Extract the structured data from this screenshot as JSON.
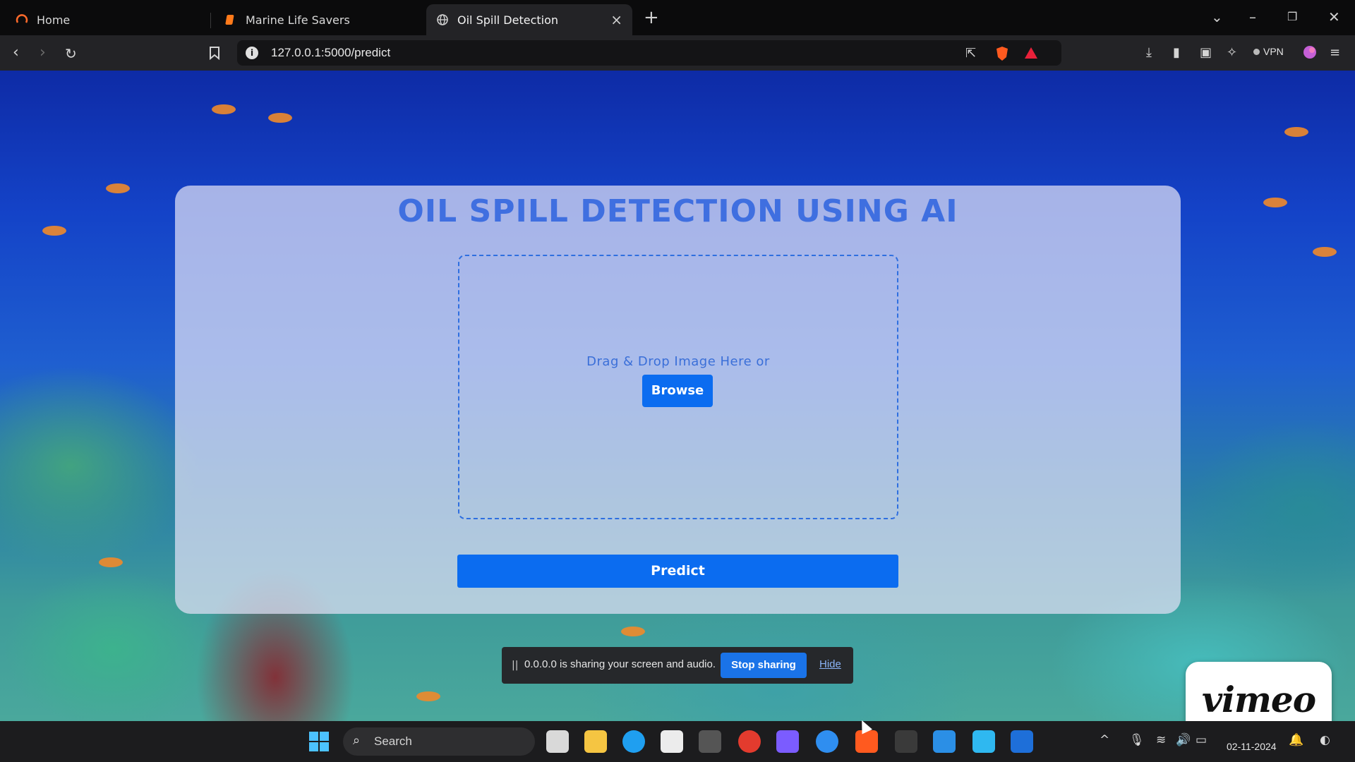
{
  "browser": {
    "tabs": [
      {
        "label": "Home",
        "active": false,
        "icon": "brave-news-icon"
      },
      {
        "label": "Marine Life Savers",
        "active": false,
        "icon": "document-icon"
      },
      {
        "label": "Oil Spill Detection",
        "active": true,
        "icon": "globe-icon"
      }
    ],
    "url": "127.0.0.1:5000/predict",
    "vpn_label": "VPN"
  },
  "page": {
    "title": "OIL SPILL DETECTION USING AI",
    "dropzone_text": "Drag & Drop Image Here or",
    "browse_label": "Browse",
    "predict_label": "Predict"
  },
  "share_banner": {
    "grip": "||",
    "message": "0.0.0.0 is sharing your screen and audio.",
    "stop_label": "Stop sharing",
    "hide_label": "Hide"
  },
  "vimeo": {
    "label": "vimeo"
  },
  "taskbar": {
    "search_placeholder": "Search",
    "date": "02-11-2024"
  },
  "colors": {
    "accent": "#0b6cf0",
    "title": "#3f6fe0",
    "share_button": "#1a73e8"
  }
}
